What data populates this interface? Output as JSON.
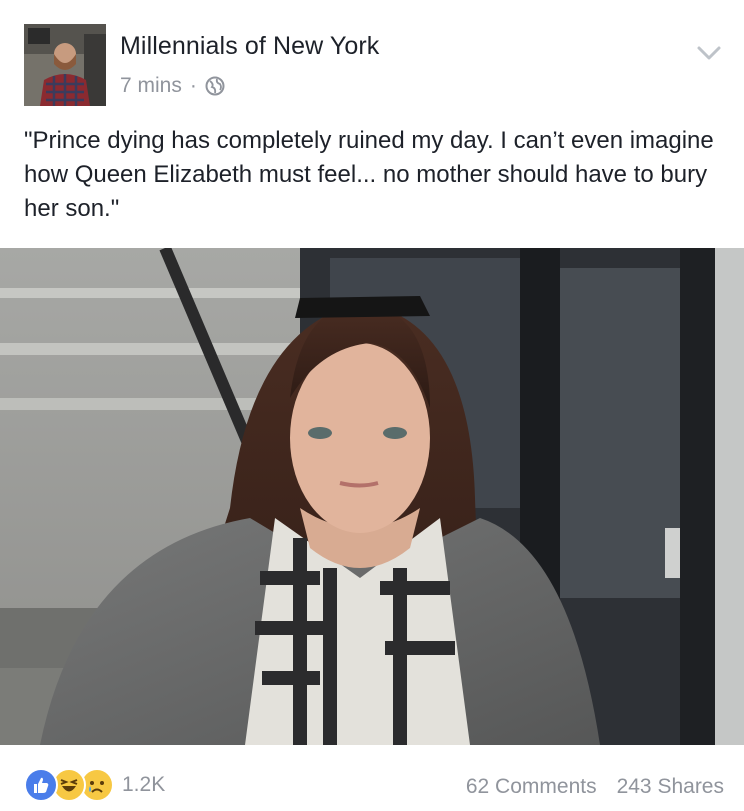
{
  "post": {
    "page_name": "Millennials of New York",
    "timestamp": "7 mins",
    "separator": "·",
    "audience_icon": "globe-icon",
    "menu_icon": "chevron-down-icon",
    "text": "\"Prince dying has completely ruined my day. I can’t even imagine how Queen Elizabeth must feel... no mother should have to bury her son.\""
  },
  "reactions": {
    "icons": [
      "like-icon",
      "haha-icon",
      "sad-icon"
    ],
    "count": "1.2K"
  },
  "stats": {
    "comments": "62 Comments",
    "shares": "243 Shares"
  },
  "colors": {
    "text": "#1d2129",
    "meta": "#90949c",
    "like_blue": "#4a7dea",
    "emoji_yellow": "#f7c843"
  }
}
